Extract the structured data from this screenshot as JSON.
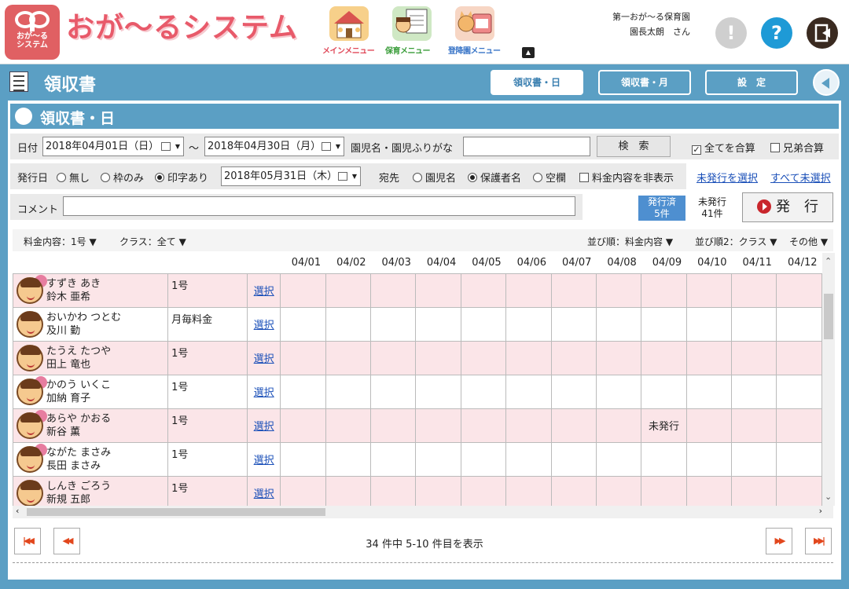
{
  "header": {
    "logo_text": "おが～る\nシステム",
    "app_title": "おが～るシステム",
    "menus": [
      {
        "label": "メインメニュー",
        "color": "#e04a5a"
      },
      {
        "label": "保育メニュー",
        "color": "#3a9d3a"
      },
      {
        "label": "登降園メニュー",
        "color": "#3a76c8"
      }
    ],
    "facility": "第一おが～る保育園",
    "user": "園長太朗　さん",
    "alert_icon": "!",
    "help_icon": "?"
  },
  "titlebar": {
    "title": "領収書",
    "tabs": [
      "領収書・日",
      "領収書・月",
      "設　定"
    ]
  },
  "section": {
    "title": "領収書・日"
  },
  "search": {
    "date_label": "日付",
    "date_from": "2018年04月01日（日）",
    "tilde": "～",
    "date_to": "2018年04月30日（月）",
    "name_label": "園児名・園児ふりがな",
    "name_value": "",
    "search_button": "検　索",
    "sum_all": "全てを合算",
    "sum_all_checked": true,
    "sibling_sum": "兄弟合算",
    "sibling_sum_checked": false
  },
  "issue_opts": {
    "issue_date_label": "発行日",
    "options": [
      "無し",
      "枠のみ",
      "印字あり"
    ],
    "selected": 2,
    "issue_date": "2018年05月31日（木）",
    "dest_label": "宛先",
    "dest_options": [
      "園児名",
      "保護者名",
      "空欄"
    ],
    "dest_selected": 1,
    "hide_fee": "料金内容を非表示",
    "select_unissued": "未発行を選択",
    "deselect_all": "すべて未選択"
  },
  "comment": {
    "label": "コメント",
    "value": ""
  },
  "status": {
    "issued_label": "発行済",
    "issued_count": "5件",
    "unissued_label": "未発行",
    "unissued_count": "41件",
    "issue_button": "発　行"
  },
  "filters": {
    "fee": "料金内容：1号 ▼",
    "class": "クラス：全て ▼",
    "sort1": "並び順：料金内容 ▼",
    "sort2": "並び順2：クラス ▼",
    "other": "その他 ▼"
  },
  "grid": {
    "dates": [
      "04/01",
      "04/02",
      "04/03",
      "04/04",
      "04/05",
      "04/06",
      "04/07",
      "04/08",
      "04/09",
      "04/10",
      "04/11",
      "04/12"
    ],
    "select_label": "選択",
    "rows": [
      {
        "kana": "すずき あき",
        "name": "鈴木 亜希",
        "fee": "1号",
        "girl": true,
        "pink": true,
        "marks": {}
      },
      {
        "kana": "おいかわ つとむ",
        "name": "及川 勤",
        "fee": "月毎料金",
        "girl": false,
        "pink": false,
        "marks": {}
      },
      {
        "kana": "たうえ たつや",
        "name": "田上 竜也",
        "fee": "1号",
        "girl": false,
        "pink": true,
        "marks": {}
      },
      {
        "kana": "かのう いくこ",
        "name": "加納 育子",
        "fee": "1号",
        "girl": true,
        "pink": false,
        "marks": {}
      },
      {
        "kana": "あらや かおる",
        "name": "新谷 薫",
        "fee": "1号",
        "girl": true,
        "pink": true,
        "marks": {
          "8": "未発行"
        }
      },
      {
        "kana": "ながた まさみ",
        "name": "長田 まさみ",
        "fee": "1号",
        "girl": true,
        "pink": false,
        "marks": {}
      },
      {
        "kana": "しんき ごろう",
        "name": "新規 五郎",
        "fee": "1号",
        "girl": false,
        "pink": true,
        "marks": {}
      }
    ]
  },
  "pagination": {
    "info": "34 件中 5-10 件目を表示",
    "first": "⏮",
    "prev": "◀◀",
    "next": "▶▶",
    "last": "⏭"
  }
}
